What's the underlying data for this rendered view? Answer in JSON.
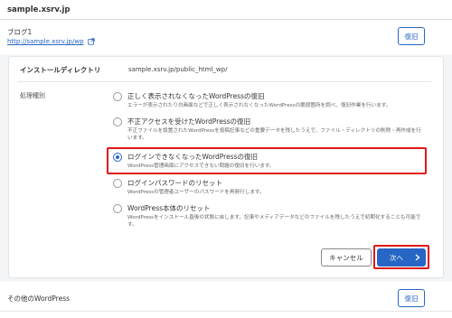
{
  "header": {
    "site": "sample.xsrv.jp"
  },
  "blog": {
    "label": "ブログ1",
    "url": "http://sample.xsrv.jp/wp",
    "restore_label": "復旧"
  },
  "panel": {
    "install_label": "インストールディレクトリ",
    "install_value": "sample.xsrv.jp/public_html_wp/",
    "type_label": "処理種別",
    "options": [
      {
        "title": "正しく表示されなくなったWordPressの復旧",
        "desc": "エラーが表示されたり白画面などで正しく表示されなくなったWordPressの脆弱箇所を調べ、復旧作業を行います。",
        "checked": false
      },
      {
        "title": "不正アクセスを受けたWordPressの復旧",
        "desc": "不正ファイルを設置されたWordPressを投稿記事などの重要データを残したうえで、ファイル・ディレクトリの削除・再作成を行います。",
        "checked": false
      },
      {
        "title": "ログインできなくなったWordPressの復旧",
        "desc": "WordPress管理画面にアクセスできない問題の復旧を行います。",
        "checked": true
      },
      {
        "title": "ログインパスワードのリセット",
        "desc": "WordPressの管理者ユーザーのパスワードを再発行します。",
        "checked": false
      },
      {
        "title": "WordPress本体のリセット",
        "desc": "WordPressをインストール直後の状態に戻します。記事やメディアデータなどのファイルを残したうえで初期化することも可能です。",
        "checked": false
      }
    ],
    "cancel_label": "キャンセル",
    "next_label": "次へ"
  },
  "other": {
    "label": "その他のWordPress",
    "restore_label": "復旧"
  },
  "colors": {
    "accent": "#2766c5",
    "highlight": "#e01818"
  },
  "icons": {
    "external": "external-link-icon",
    "next": "chevron-right-icon"
  }
}
